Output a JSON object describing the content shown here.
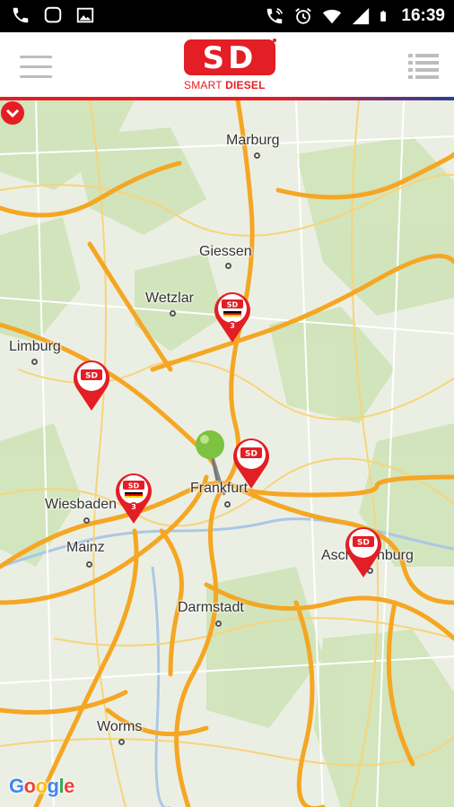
{
  "status_bar": {
    "time": "16:39",
    "left_icons": [
      "phone-icon",
      "chat-bubble-icon",
      "image-icon"
    ],
    "right_icons": [
      "wifi-call-icon",
      "alarm-icon",
      "wifi-icon",
      "signal-icon",
      "battery-icon"
    ]
  },
  "header": {
    "logo_text": "SD",
    "brand_word_1": "SMART",
    "brand_word_2": "DIESEL",
    "menu_icon": "hamburger-icon",
    "list_icon": "list-icon"
  },
  "colors": {
    "brand_red": "#e31e24",
    "brand_blue": "#2c3e9e",
    "road_orange": "#f5a623",
    "pin_green": "#7dc241"
  },
  "map": {
    "cities": [
      {
        "name": "Marburg"
      },
      {
        "name": "Giessen"
      },
      {
        "name": "Wetzlar"
      },
      {
        "name": "Limburg"
      },
      {
        "name": "Wiesbaden"
      },
      {
        "name": "Frankfurt"
      },
      {
        "name": "Mainz"
      },
      {
        "name": "Darmstadt"
      },
      {
        "name": "Aschaffenburg"
      },
      {
        "name": "Worms"
      }
    ],
    "stations": [
      {
        "label": "SD",
        "badge": "3",
        "flag": "de"
      },
      {
        "label": "SD",
        "badge": "",
        "flag": ""
      },
      {
        "label": "SD",
        "badge": "",
        "flag": ""
      },
      {
        "label": "SD",
        "badge": "3",
        "flag": "de"
      },
      {
        "label": "SD",
        "badge": "",
        "flag": ""
      }
    ],
    "attribution": {
      "g1": "G",
      "o1": "o",
      "o2": "o",
      "g2": "g",
      "l": "l",
      "e": "e"
    }
  }
}
